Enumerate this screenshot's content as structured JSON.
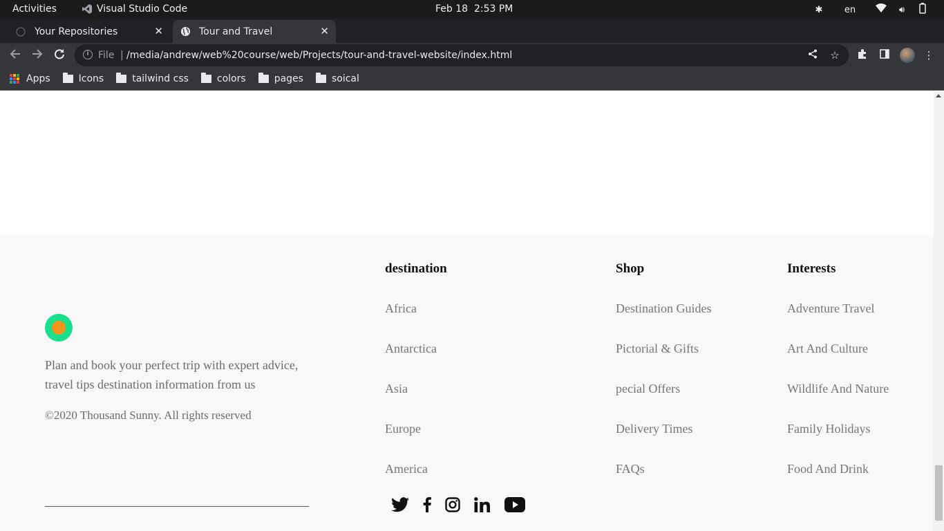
{
  "system_bar": {
    "activities": "Activities",
    "app_name": "Visual Studio Code",
    "date": "Feb 18",
    "time": "2:53 PM",
    "language": "en"
  },
  "browser": {
    "tabs": [
      {
        "title": "Your Repositories",
        "icon": "github-icon"
      },
      {
        "title": "Tour and Travel",
        "icon": "globe-icon",
        "active": true
      }
    ],
    "address": {
      "scheme_label": "File",
      "separator": "|",
      "url": "/media/andrew/web%20course/web/Projects/tour-and-travel-website/index.html"
    },
    "bookmarks": [
      {
        "label": "Apps",
        "icon": "apps-grid-icon"
      },
      {
        "label": "Icons",
        "icon": "folder-icon"
      },
      {
        "label": "tailwind css",
        "icon": "folder-icon"
      },
      {
        "label": "colors",
        "icon": "folder-icon"
      },
      {
        "label": "pages",
        "icon": "folder-icon"
      },
      {
        "label": "soical",
        "icon": "folder-icon"
      }
    ]
  },
  "footer": {
    "brand_colors": {
      "outer": "#18e08c",
      "inner": "#f5951d"
    },
    "about": "Plan and book your perfect trip with expert advice, travel tips destination information from us",
    "copyright": "©2020 Thousand Sunny. All rights reserved",
    "columns": [
      {
        "heading": "destination",
        "links": [
          "Africa",
          "Antarctica",
          "Asia",
          "Europe",
          "America"
        ]
      },
      {
        "heading": "Shop",
        "links": [
          "Destination Guides",
          "Pictorial & Gifts",
          "pecial Offers",
          "Delivery Times",
          "FAQs"
        ]
      },
      {
        "heading": "Interests",
        "links": [
          "Adventure Travel",
          "Art And Culture",
          "Wildlife And Nature",
          "Family Holidays",
          "Food And Drink"
        ]
      }
    ],
    "social": [
      "twitter-icon",
      "facebook-icon",
      "instagram-icon",
      "linkedin-icon",
      "youtube-icon"
    ]
  }
}
